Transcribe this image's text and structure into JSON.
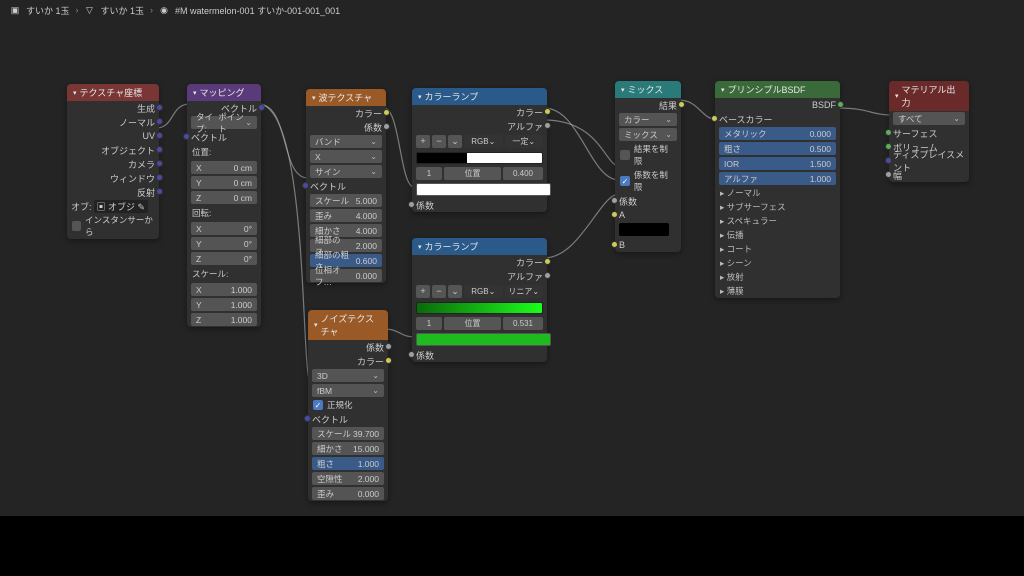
{
  "breadcrumb": {
    "item1": "すいか 1玉",
    "item2": "すいか 1玉",
    "item3": "#M watermelon-001 すいか-001-001_001"
  },
  "nodes": {
    "texcoord": {
      "title": "テクスチャ座標",
      "outs": [
        "生成",
        "ノーマル",
        "UV",
        "オブジェクト",
        "カメラ",
        "ウィンドウ",
        "反射"
      ],
      "obj_label": "オブ:",
      "obj_value": "オブジ",
      "inst": "インスタンサーから"
    },
    "mapping": {
      "title": "マッピング",
      "out": "ベクトル",
      "type_label": "タイプ:",
      "type_value": "ポイント",
      "vec_in": "ベクトル",
      "loc_label": "位置:",
      "loc": {
        "x": "X",
        "y": "Y",
        "z": "Z",
        "xv": "0 cm",
        "yv": "0 cm",
        "zv": "0 cm"
      },
      "rot_label": "回転:",
      "rot": {
        "x": "X",
        "y": "Y",
        "z": "Z",
        "xv": "0°",
        "yv": "0°",
        "zv": "0°"
      },
      "scale_label": "スケール:",
      "scale": {
        "x": "X",
        "y": "Y",
        "z": "Z",
        "xv": "1.000",
        "yv": "1.000",
        "zv": "1.000"
      }
    },
    "wave": {
      "title": "波テクスチャ",
      "out_color": "カラー",
      "out_fac": "係数",
      "p1": "バンド",
      "p2": "X",
      "p3": "サイン",
      "vec_in": "ベクトル",
      "scale": {
        "l": "スケール",
        "v": "5.000"
      },
      "distort": {
        "l": "歪み",
        "v": "4.000"
      },
      "detail": {
        "l": "細かさ",
        "v": "4.000"
      },
      "detail_s": {
        "l": "細部のス…",
        "v": "2.000"
      },
      "detail_r": {
        "l": "細部の粗さ",
        "v": "0.600"
      },
      "phase": {
        "l": "位相オフ…",
        "v": "0.000"
      }
    },
    "noise": {
      "title": "ノイズテクスチャ",
      "out_fac": "係数",
      "out_color": "カラー",
      "dim": "3D",
      "type": "fBM",
      "norm": "正規化",
      "vec_in": "ベクトル",
      "scale": {
        "l": "スケール",
        "v": "39.700"
      },
      "detail": {
        "l": "細かさ",
        "v": "15.000"
      },
      "rough": {
        "l": "粗さ",
        "v": "1.000"
      },
      "lacun": {
        "l": "空隙性",
        "v": "2.000"
      },
      "distort": {
        "l": "歪み",
        "v": "0.000"
      }
    },
    "ramp1": {
      "title": "カラーランプ",
      "out_color": "カラー",
      "out_alpha": "アルファ",
      "mode1": "RGB",
      "mode2": "一定",
      "idx": "1",
      "pos_l": "位置",
      "pos_v": "0.400",
      "fac_in": "係数"
    },
    "ramp2": {
      "title": "カラーランプ",
      "out_color": "カラー",
      "out_alpha": "アルファ",
      "mode1": "RGB",
      "mode2": "リニア",
      "idx": "1",
      "pos_l": "位置",
      "pos_v": "0.531",
      "fac_in": "係数"
    },
    "mix": {
      "title": "ミックス",
      "out": "結果",
      "type": "カラー",
      "blend": "ミックス",
      "clamp_r": "結果を制限",
      "clamp_f": "係数を制限",
      "fac": "係数",
      "a": "A",
      "b": "B"
    },
    "bsdf": {
      "title": "プリンシプルBSDF",
      "out": "BSDF",
      "base": "ベースカラー",
      "metal": {
        "l": "メタリック",
        "v": "0.000"
      },
      "rough": {
        "l": "粗さ",
        "v": "0.500"
      },
      "ior": {
        "l": "IOR",
        "v": "1.500"
      },
      "alpha": {
        "l": "アルファ",
        "v": "1.000"
      },
      "sections": [
        "ノーマル",
        "サブサーフェス",
        "スペキュラー",
        "伝播",
        "コート",
        "シーン",
        "放射",
        "薄膜"
      ]
    },
    "output": {
      "title": "マテリアル出力",
      "target": "すべて",
      "ins": [
        "サーフェス",
        "ボリューム",
        "ディスプレイスメント",
        "幅"
      ]
    }
  }
}
